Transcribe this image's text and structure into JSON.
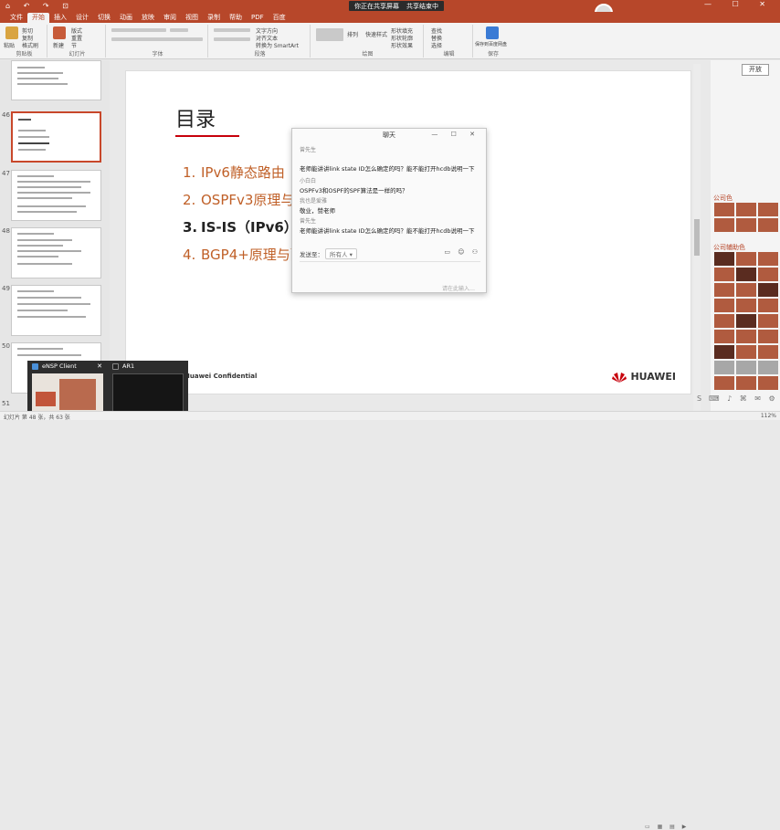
{
  "titlebar": {
    "quick_access": "⌂ ↶ ↷ ⊡",
    "share_status": "你正在共享屏幕",
    "share_stop": "共享结束中",
    "window_controls": "— ☐ ✕"
  },
  "tabs": [
    "文件",
    "开始",
    "插入",
    "设计",
    "切换",
    "动画",
    "放映",
    "审阅",
    "视图",
    "录制",
    "帮助",
    "PDF",
    "百度"
  ],
  "ribbon": {
    "groups": [
      "剪贴板",
      "幻灯片",
      "字体",
      "段落",
      "绘图",
      "编辑",
      "保存"
    ],
    "paste": "粘贴",
    "cut": "剪切",
    "copy": "复制",
    "format_painter": "格式刷",
    "new_slide": "新建",
    "layout": "版式",
    "reset": "重置",
    "section": "节",
    "text_direction": "文字方向",
    "align_text": "对齐文本",
    "smartart": "转换为 SmartArt",
    "arrange": "排列",
    "quick_styles": "快速样式",
    "shape_fill": "形状填充",
    "shape_outline": "形状轮廓",
    "shape_effects": "形状效果",
    "find": "查找",
    "replace": "替换",
    "select": "选择",
    "save_baidu": "保存到百度网盘"
  },
  "slide_panel": {
    "numbers": [
      "46",
      "47",
      "48",
      "49",
      "50",
      "51"
    ]
  },
  "slide": {
    "title": "目录",
    "items": [
      {
        "num": "1.",
        "text": "IPv6静态路由",
        "bold": false
      },
      {
        "num": "2.",
        "text": "OSPFv3原理与配",
        "bold": false
      },
      {
        "num": "3.",
        "text": "IS-IS（IPv6）原",
        "bold": true
      },
      {
        "num": "4.",
        "text": "BGP4+原理与配",
        "bold": false
      }
    ],
    "confidential": "Huawei Confidential",
    "logo_text": "HUAWEI"
  },
  "chat": {
    "title": "聊天",
    "window_controls": "— ☐ ✕",
    "messages": [
      {
        "name": "曾先生",
        "text": "老师能讲讲link state ID怎么确定的吗？能不能打开hcdb说明一下"
      },
      {
        "name": "小白白",
        "text": "OSPFv3和OSPF的SPF算法是一样的吗？"
      },
      {
        "name": "我也是爱雅",
        "text": "敬业，赞老师"
      },
      {
        "name": "曾先生",
        "text": "老师能讲讲link state ID怎么确定的吗？能不能打开hcdb说明一下"
      }
    ],
    "send_to_label": "发送至：",
    "send_to_value": "所有人 ▾",
    "icons": "▭ ☺ ⚇",
    "input_placeholder": "请在此输入…"
  },
  "right_panel": {
    "mode_button": "开放",
    "head1": "公司色",
    "head2": "公司辅助色"
  },
  "taskbar_popup": {
    "app1": "eNSP Client",
    "app2": "AR1"
  },
  "status": {
    "left": "幻灯片 第 48 张，共 63 张",
    "right": "112%"
  },
  "colors": {
    "accent": "#b7472a",
    "brand_red": "#c7000b",
    "slide_text": "#c06028"
  }
}
